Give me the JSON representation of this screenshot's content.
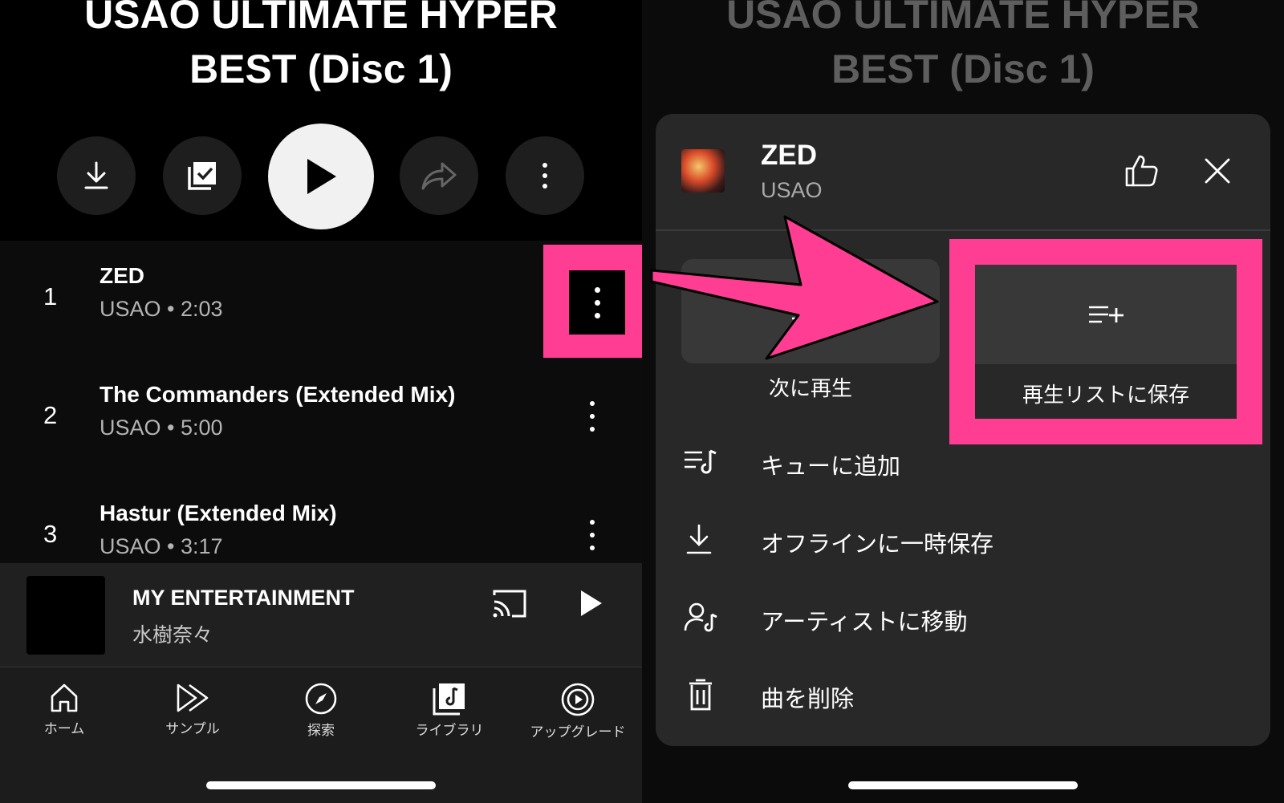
{
  "album": {
    "title_line1": "USAO ULTIMATE HYPER",
    "title_line2": "BEST (Disc 1)"
  },
  "tracks": [
    {
      "number": "1",
      "title": "ZED",
      "subtitle": "USAO • 2:03"
    },
    {
      "number": "2",
      "title": "The Commanders (Extended Mix)",
      "subtitle": "USAO • 5:00"
    },
    {
      "number": "3",
      "title": "Hastur (Extended Mix)",
      "subtitle": "USAO • 3:17"
    }
  ],
  "mini_player": {
    "title": "MY ENTERTAINMENT",
    "artist": "水樹奈々"
  },
  "nav": [
    {
      "label": "ホーム",
      "icon": "home-icon"
    },
    {
      "label": "サンプル",
      "icon": "samples-icon"
    },
    {
      "label": "探索",
      "icon": "explore-icon"
    },
    {
      "label": "ライブラリ",
      "icon": "library-icon"
    },
    {
      "label": "アップグレード",
      "icon": "upgrade-icon"
    }
  ],
  "sheet": {
    "song_title": "ZED",
    "song_artist": "USAO",
    "tiles": [
      {
        "label": "次に再生",
        "icon": "play-next-icon"
      },
      {
        "label": "再生リストに保存",
        "icon": "playlist-add-icon"
      }
    ],
    "menu": [
      {
        "label": "キューに追加",
        "icon": "queue-add-icon"
      },
      {
        "label": "オフラインに一時保存",
        "icon": "download-icon"
      },
      {
        "label": "アーティストに移動",
        "icon": "artist-icon"
      },
      {
        "label": "曲を削除",
        "icon": "trash-icon"
      }
    ]
  },
  "colors": {
    "highlight": "#ff3d92",
    "background": "#000000",
    "sheet": "#282828"
  }
}
